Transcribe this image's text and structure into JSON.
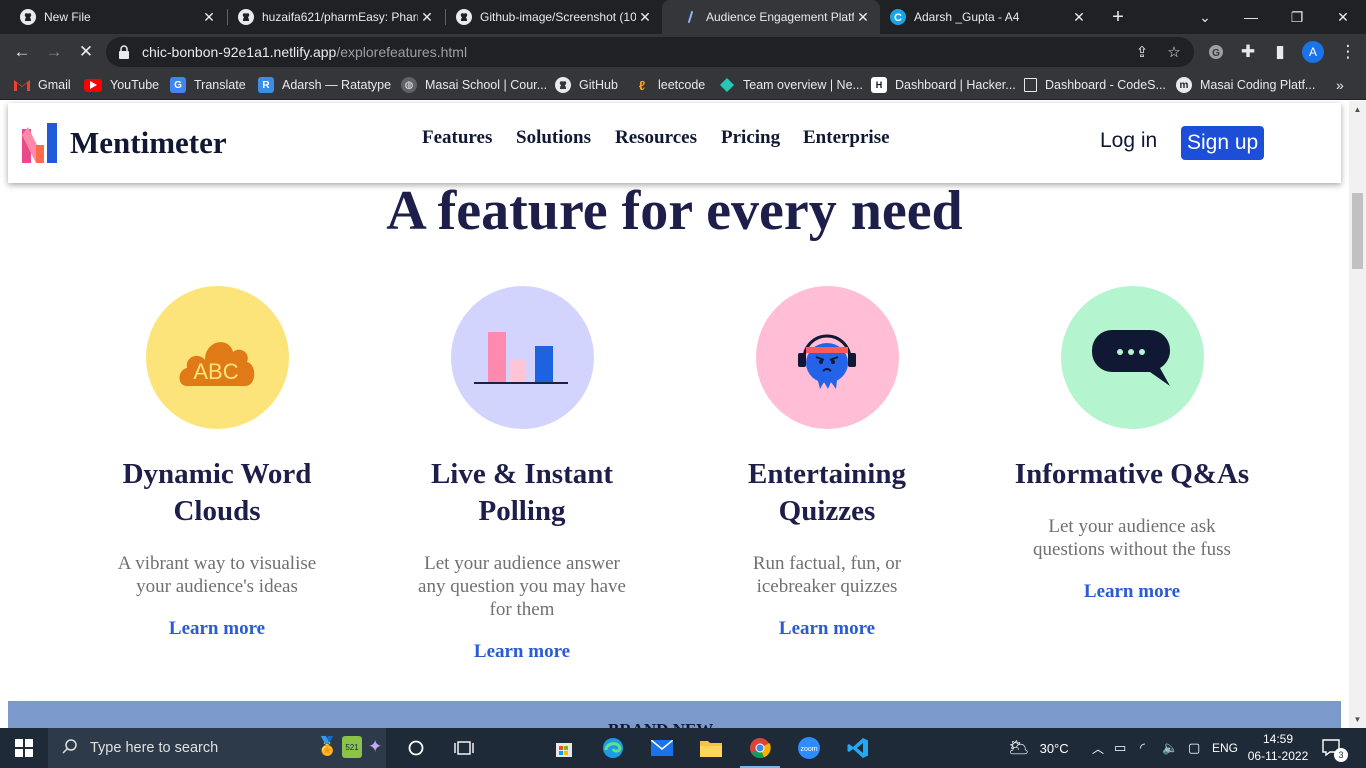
{
  "browser": {
    "tabs": [
      {
        "title": "New File",
        "icon": "github-icon",
        "active": false
      },
      {
        "title": "huzaifa621/pharmEasy: Pharm",
        "icon": "github-icon",
        "active": false
      },
      {
        "title": "Github-image/Screenshot (10",
        "icon": "github-icon",
        "active": false
      },
      {
        "title": "Audience Engagement Platfo",
        "icon": "loading-icon",
        "active": true
      },
      {
        "title": "Adarsh _Gupta - A4",
        "icon": "canva-icon",
        "active": false
      }
    ],
    "url_host": "chic-bonbon-92e1a1.netlify.app",
    "url_path": "/explorefeatures.html",
    "avatar_letter": "A",
    "bookmarks": [
      {
        "label": "Gmail",
        "icon": "gmail-icon"
      },
      {
        "label": "YouTube",
        "icon": "youtube-icon"
      },
      {
        "label": "Translate",
        "icon": "translate-icon"
      },
      {
        "label": "Adarsh — Ratatype",
        "icon": "ratatype-icon"
      },
      {
        "label": "Masai School | Cour...",
        "icon": "globe-icon"
      },
      {
        "label": "GitHub",
        "icon": "github-icon"
      },
      {
        "label": "leetcode",
        "icon": "leetcode-icon"
      },
      {
        "label": "Team overview | Ne...",
        "icon": "netlify-icon"
      },
      {
        "label": "Dashboard | Hacker...",
        "icon": "hackerrank-icon"
      },
      {
        "label": "Dashboard - CodeS...",
        "icon": "page-icon"
      },
      {
        "label": "Masai Coding Platf...",
        "icon": "masai-icon"
      }
    ]
  },
  "site": {
    "brand": "Mentimeter",
    "nav": [
      "Features",
      "Solutions",
      "Resources",
      "Pricing",
      "Enterprise"
    ],
    "login": "Log in",
    "signup": "Sign up",
    "headline": "A feature for every need",
    "features": [
      {
        "title": "Dynamic Word Clouds",
        "desc": "A vibrant way to visualise your audience's ideas",
        "link": "Learn more",
        "circle_color": "#fde47a",
        "icon": "word-cloud-icon",
        "icon_text": "ABC"
      },
      {
        "title": "Live & Instant Polling",
        "desc": "Let your audience answer any question you may have for them",
        "link": "Learn more",
        "circle_color": "#d3d4fd",
        "icon": "bar-chart-icon"
      },
      {
        "title": "Entertaining Quizzes",
        "desc": "Run factual, fun, or icebreaker quizzes",
        "link": "Learn more",
        "circle_color": "#ffbed6",
        "icon": "quiz-character-icon"
      },
      {
        "title": "Informative Q&As",
        "desc": "Let your audience ask questions without the fuss",
        "link": "Learn more",
        "circle_color": "#b4f5d0",
        "icon": "speech-bubble-icon"
      }
    ],
    "band_text": "BRAND NEW"
  },
  "taskbar": {
    "search_placeholder": "Type here to search",
    "weather": "30°C",
    "language": "ENG",
    "time": "14:59",
    "date": "06-11-2022",
    "notifications": "3"
  }
}
